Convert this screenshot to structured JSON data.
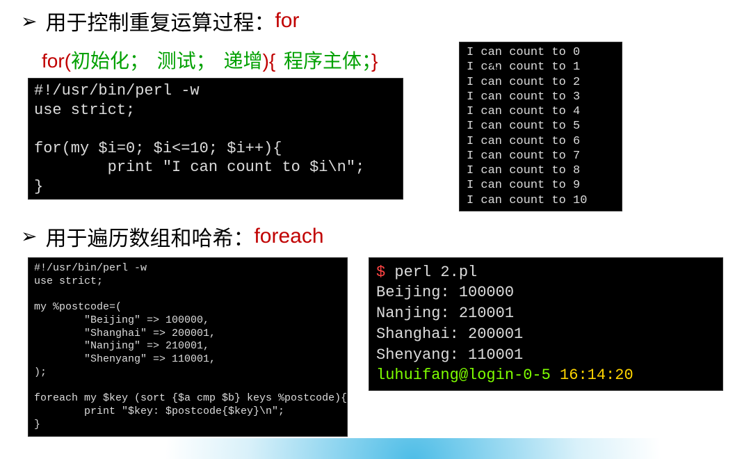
{
  "section1": {
    "bullet_text": "用于控制重复运算过程：",
    "bullet_keyword": "for",
    "syntax_parts": {
      "p1": "for(",
      "p2": "初始化； 测试； 递增",
      "p3": "){ ",
      "p4": "程序主体；",
      "p5": "}"
    },
    "code": "#!/usr/bin/perl -w\nuse strict;\n\nfor(my $i=0; $i<=10; $i++){\n        print \"I can count to $i\\n\";\n}",
    "output": "I can count to 0\nI can count to 1\nI can count to 2\nI can count to 3\nI can count to 4\nI can count to 5\nI can count to 6\nI can count to 7\nI can count to 8\nI can count to 9\nI can count to 10"
  },
  "section2": {
    "bullet_text": "用于遍历数组和哈希：",
    "bullet_keyword": "foreach",
    "code": "#!/usr/bin/perl -w\nuse strict;\n\nmy %postcode=(\n        \"Beijing\" => 100000,\n        \"Shanghai\" => 200001,\n        \"Nanjing\" => 210001,\n        \"Shenyang\" => 110001,\n);\n\nforeach my $key (sort {$a cmp $b} keys %postcode){\n        print \"$key: $postcode{$key}\\n\";\n}",
    "output": {
      "prompt_sym": "$ ",
      "prompt_cmd": "perl 2.pl",
      "lines": "Beijing: 100000\nNanjing: 210001\nShanghai: 200001\nShenyang: 110001",
      "user_host": "luhuifang@login-0-5 ",
      "time": "16:14:20"
    }
  }
}
